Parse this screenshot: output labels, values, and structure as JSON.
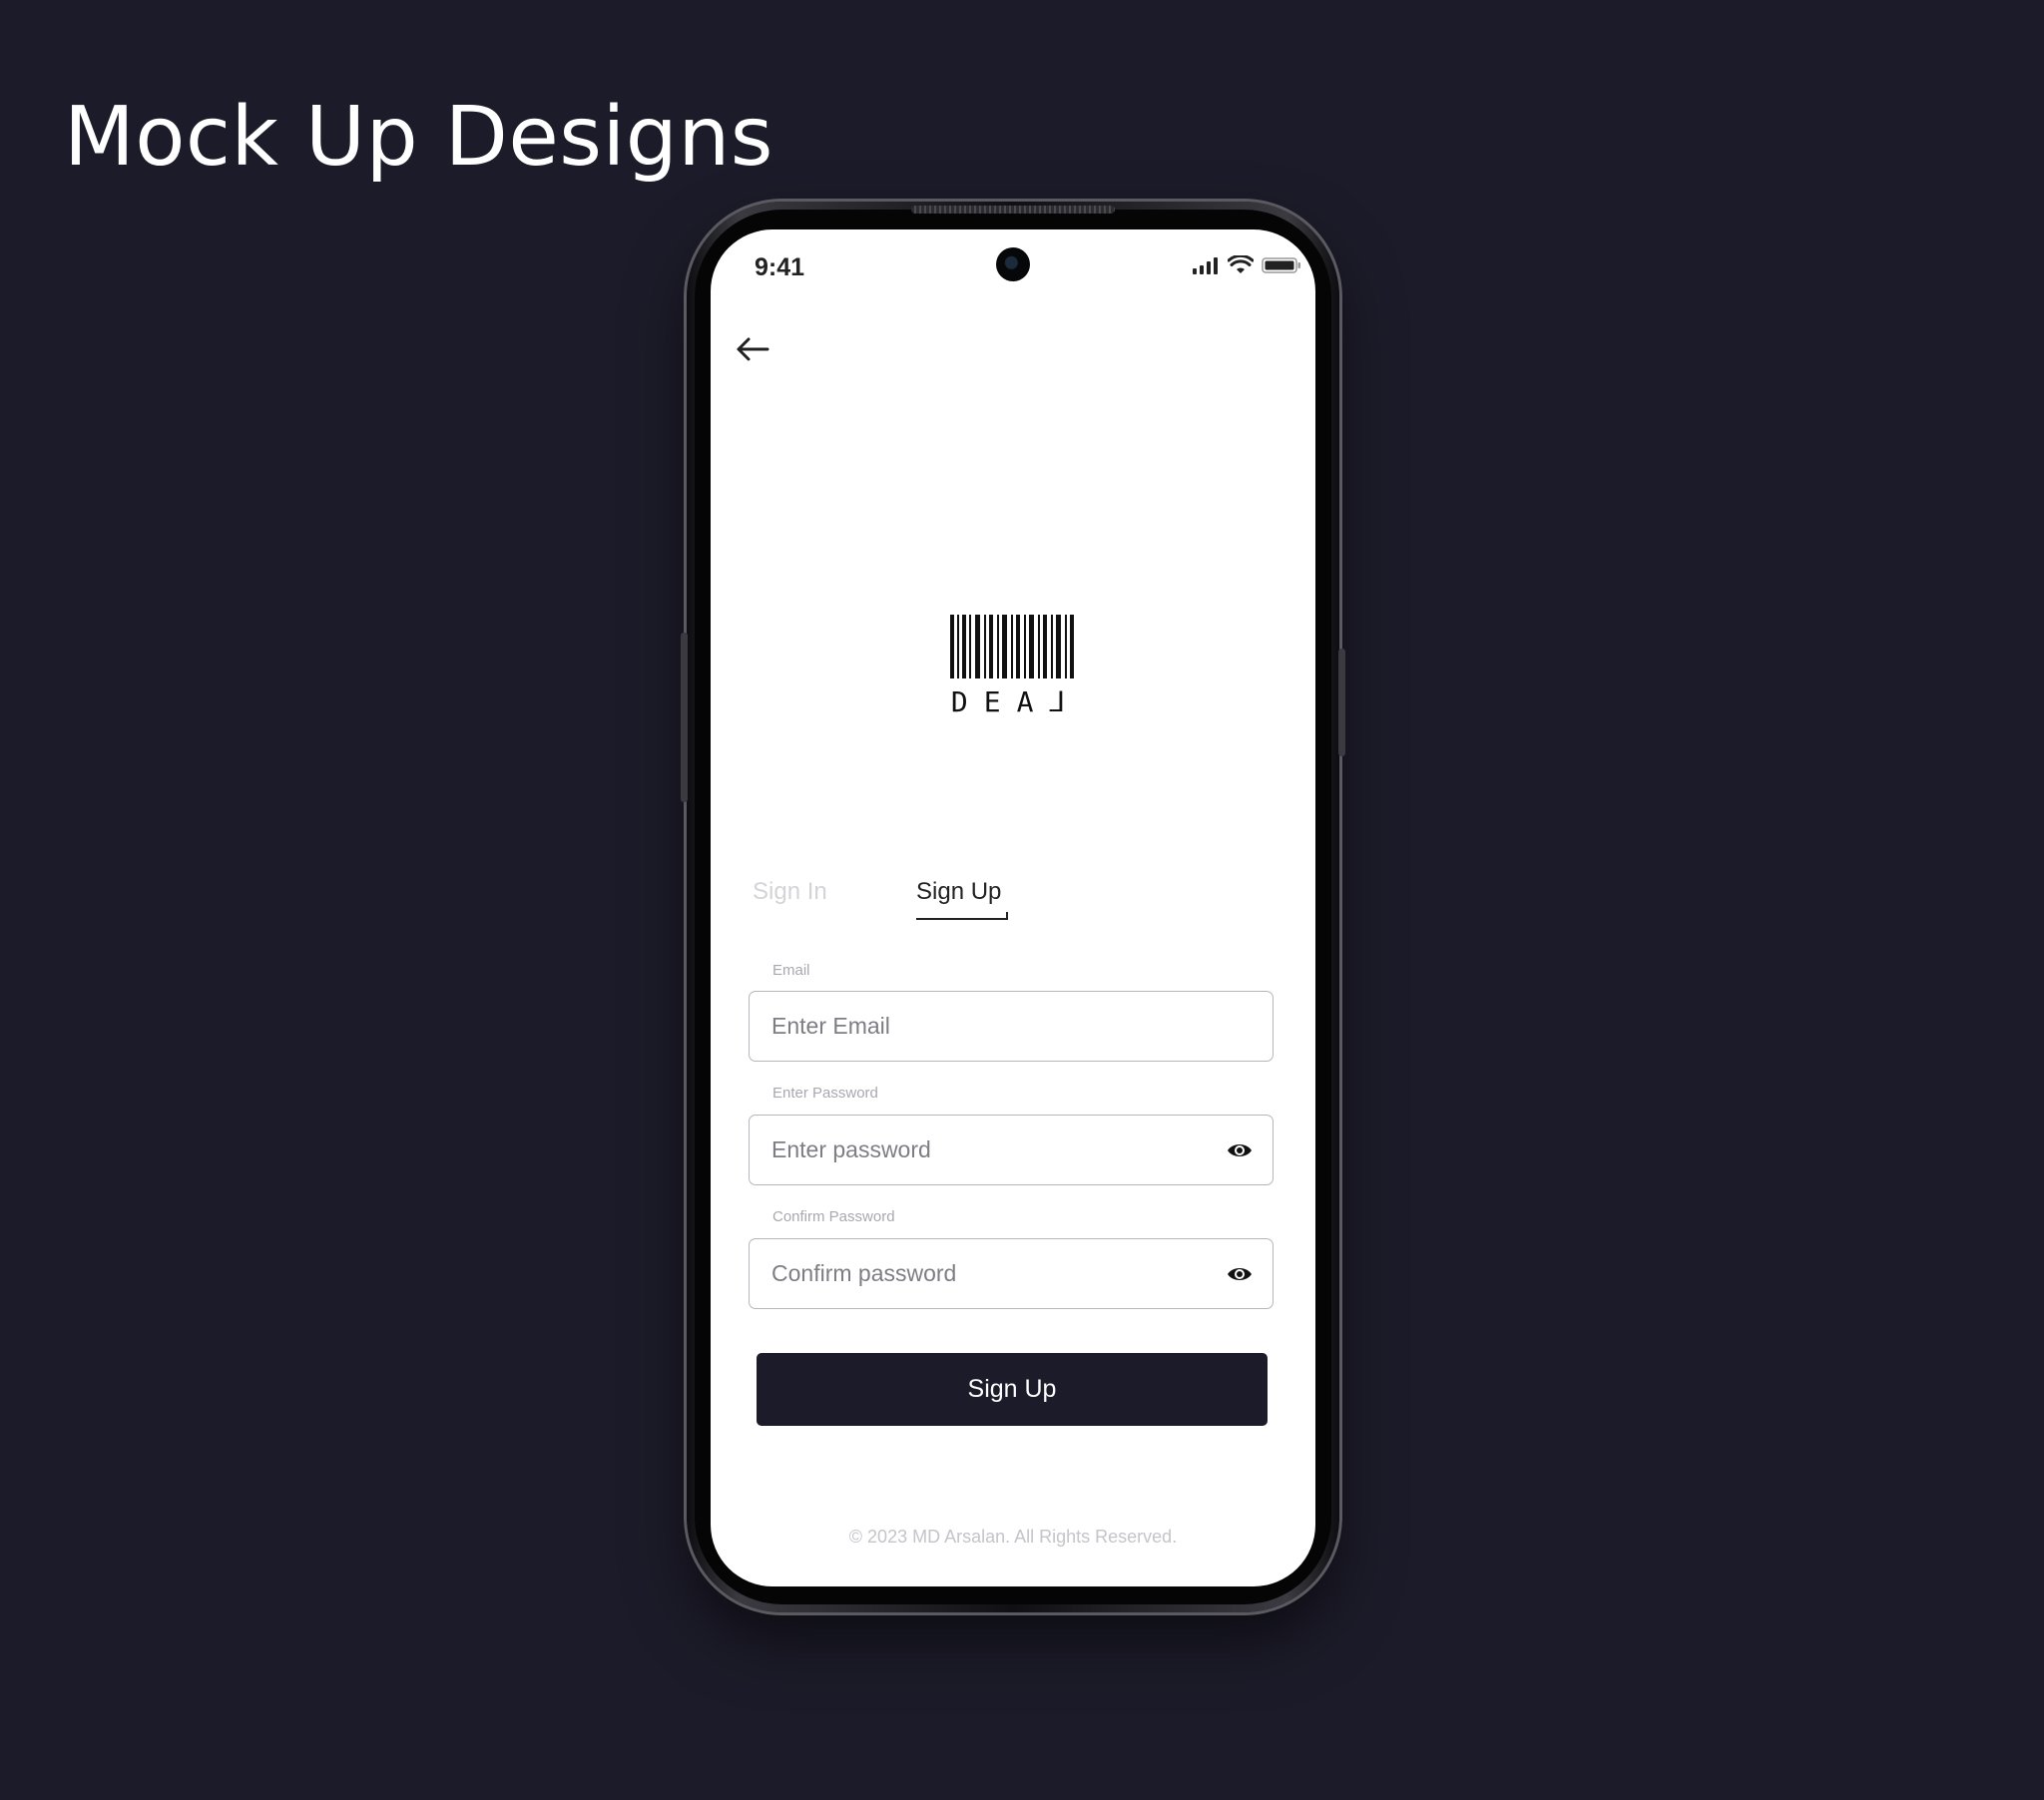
{
  "page": {
    "title": "Mock Up Designs"
  },
  "status_bar": {
    "time": "9:41"
  },
  "icons": {
    "back": "arrow-left-icon",
    "signal": "cellular-signal-icon",
    "wifi": "wifi-icon",
    "battery": "battery-icon",
    "eye": "eye-icon"
  },
  "logo": {
    "text": "DEA⅃"
  },
  "tabs": [
    {
      "label": "Sign In",
      "active": false
    },
    {
      "label": "Sign Up",
      "active": true
    }
  ],
  "form": {
    "email": {
      "label": "Email",
      "placeholder": "Enter Email",
      "value": ""
    },
    "password": {
      "label": "Enter Password",
      "placeholder": "Enter password",
      "value": ""
    },
    "confirm_password": {
      "label": "Confirm Password",
      "placeholder": "Confirm password",
      "value": ""
    },
    "submit_label": "Sign Up"
  },
  "footer": {
    "text": "© 2023 MD Arsalan. All Rights Reserved."
  },
  "colors": {
    "background": "#1c1b29",
    "primary_button": "#1c1b29",
    "inactive_tab": "#d4d4d8",
    "screen": "#ffffff"
  }
}
